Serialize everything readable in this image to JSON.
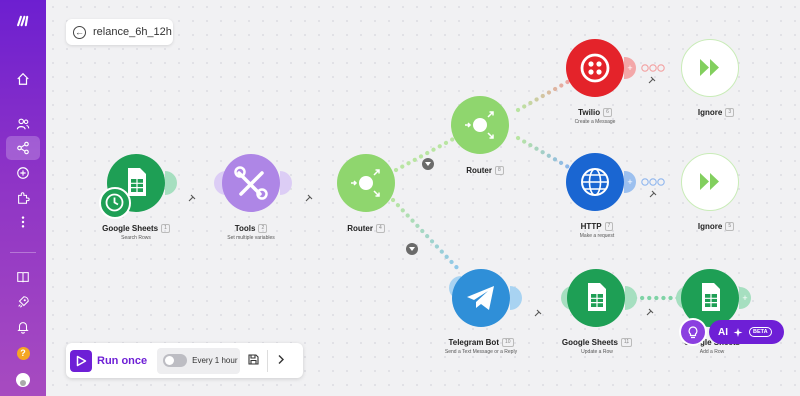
{
  "scenario": {
    "title": "relance_6h_12h"
  },
  "modules": {
    "sheets1": {
      "name": "Google Sheets",
      "num": "1",
      "sub": "Search Rows"
    },
    "tools": {
      "name": "Tools",
      "num": "2",
      "sub": "Set multiple variables"
    },
    "router1": {
      "name": "Router",
      "num": "4"
    },
    "router2": {
      "name": "Router",
      "num": "8"
    },
    "twilio": {
      "name": "Twilio",
      "num": "6",
      "sub": "Create a Message"
    },
    "ignore1": {
      "name": "Ignore",
      "num": "3"
    },
    "http": {
      "name": "HTTP",
      "num": "7",
      "sub": "Make a request"
    },
    "ignore2": {
      "name": "Ignore",
      "num": "5"
    },
    "telegram": {
      "name": "Telegram Bot",
      "num": "10",
      "sub": "Send a Text Message or a Reply"
    },
    "sheets2": {
      "name": "Google Sheets",
      "num": "11",
      "sub": "Update a Row"
    },
    "sheets3": {
      "name": "Google Sheets",
      "num": "",
      "sub": "Add a Row"
    }
  },
  "toolbar": {
    "run_label": "Run once",
    "schedule_label": "Every 1 hour"
  },
  "ai": {
    "label": "AI",
    "badge": "BETA"
  },
  "sidebar": {
    "help_label": "?"
  },
  "colors": {
    "brand_purple": "#6e1fd6",
    "sheets_green": "#1e9f55",
    "tools_purple": "#ae86e6",
    "router_green": "#8fd66e",
    "twilio_red": "#e4232a",
    "http_blue": "#1a66d2",
    "telegram_blue": "#2f8fd8"
  }
}
